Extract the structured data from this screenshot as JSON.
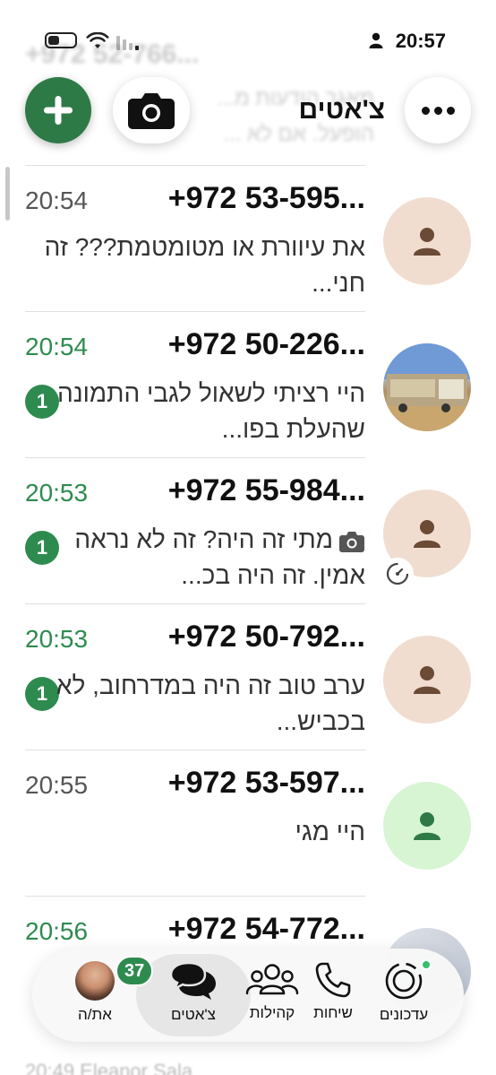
{
  "status_bar": {
    "time": "20:57"
  },
  "header": {
    "title": "צ'אטים"
  },
  "background": {
    "ghost_name": "+972 52-766...",
    "ghost_line1": "מאגר הודעות מ...",
    "ghost_line2": "הופעל. אם לא ..."
  },
  "chats": [
    {
      "name": "+972 53-595...",
      "time": "20:54",
      "preview": "את עיוורת או מטומטמת??? זה חני...",
      "unread": "",
      "avatar": "person"
    },
    {
      "name": "+972 50-226...",
      "time": "20:54",
      "preview": "היי רציתי לשאול לגבי התמונה שהעלת בפו...",
      "unread": "1",
      "avatar": "photo"
    },
    {
      "name": "+972 55-984...",
      "time": "20:53",
      "preview": "מתי זה היה? זה לא נראה אמין. זה היה בכ...",
      "unread": "1",
      "avatar": "person"
    },
    {
      "name": "+972 50-792...",
      "time": "20:53",
      "preview": "ערב טוב זה היה במדרחוב, לא בכביש...",
      "unread": "1",
      "avatar": "person"
    },
    {
      "name": "+972 53-597...",
      "time": "20:55",
      "preview": "היי מגי",
      "unread": "",
      "avatar": "person-green"
    },
    {
      "name": "+972 54-772...",
      "time": "20:56",
      "preview": "",
      "unread": "",
      "avatar": "photo"
    }
  ],
  "tab_bar": {
    "badge_count": "37",
    "tabs": [
      {
        "label": "עדכונים",
        "icon": "updates-icon"
      },
      {
        "label": "שיחות",
        "icon": "phone-icon"
      },
      {
        "label": "קהילות",
        "icon": "communities-icon"
      },
      {
        "label": "צ'אטים",
        "icon": "chats-icon"
      },
      {
        "label": "את/ה",
        "icon": "avatar"
      }
    ]
  },
  "bottom_ghost": "20:49   Eleanor Sala",
  "colors": {
    "accent": "#2e8b4f",
    "fab": "#2e7a47",
    "avatar_bg": "#f1ddd0",
    "avatar_icon": "#6b4a36"
  }
}
